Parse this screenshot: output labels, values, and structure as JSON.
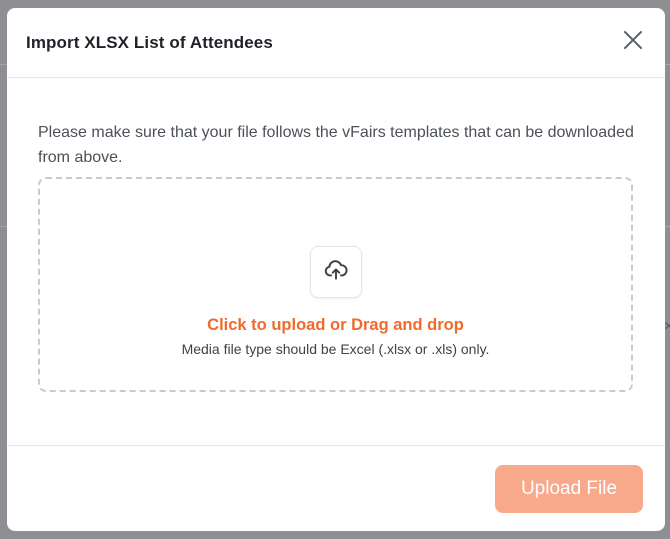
{
  "modal": {
    "title": "Import XLSX List of Attendees",
    "close_icon": "close-icon"
  },
  "body": {
    "instructions": "Please make sure that your file follows the vFairs templates that can be downloaded from above.",
    "dropzone": {
      "icon": "cloud-upload-icon",
      "title": "Click to upload or Drag and drop",
      "subtitle": "Media file type should be Excel (.xlsx or .xls) only."
    }
  },
  "footer": {
    "upload_label": "Upload File"
  },
  "colors": {
    "accent": "#f06a2c",
    "button_disabled": "#f8a98b",
    "overlay": "#8d8f93"
  }
}
